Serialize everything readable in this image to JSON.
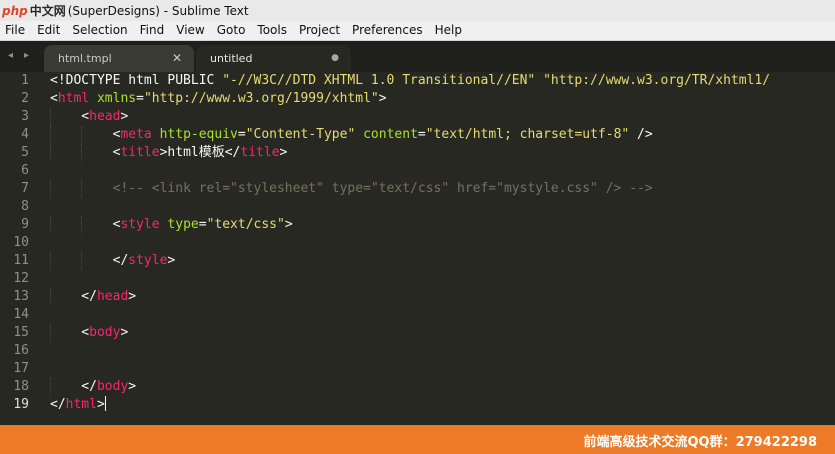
{
  "window": {
    "logo_php": "php",
    "logo_cn": "中文网",
    "title": "(SuperDesigns) - Sublime Text"
  },
  "menu": [
    "File",
    "Edit",
    "Selection",
    "Find",
    "View",
    "Goto",
    "Tools",
    "Project",
    "Preferences",
    "Help"
  ],
  "tabs": {
    "nav_left": "◂",
    "nav_right": "▸",
    "items": [
      {
        "label": "html.tmpl",
        "control": "✕",
        "active": false
      },
      {
        "label": "untitled",
        "control": "●",
        "active": true
      }
    ]
  },
  "editor": {
    "current_line": 19,
    "lines": [
      {
        "n": "1",
        "tokens": [
          {
            "t": "<!DOCTYPE html PUBLIC ",
            "c": ""
          },
          {
            "t": "\"-//W3C//DTD XHTML 1.0 Transitional//EN\"",
            "c": "s"
          },
          {
            "t": " ",
            "c": ""
          },
          {
            "t": "\"http://www.w3.org/TR/xhtml1/",
            "c": "s"
          }
        ]
      },
      {
        "n": "2",
        "tokens": [
          {
            "t": "<",
            "c": ""
          },
          {
            "t": "html",
            "c": "t"
          },
          {
            "t": " ",
            "c": ""
          },
          {
            "t": "xmlns",
            "c": "a"
          },
          {
            "t": "=",
            "c": ""
          },
          {
            "t": "\"http://www.w3.org/1999/xhtml\"",
            "c": "s"
          },
          {
            "t": ">",
            "c": ""
          }
        ]
      },
      {
        "n": "3",
        "tokens": [
          {
            "t": "    <",
            "c": ""
          },
          {
            "t": "head",
            "c": "t"
          },
          {
            "t": ">",
            "c": ""
          }
        ]
      },
      {
        "n": "4",
        "tokens": [
          {
            "t": "        <",
            "c": ""
          },
          {
            "t": "meta",
            "c": "t"
          },
          {
            "t": " ",
            "c": ""
          },
          {
            "t": "http-equiv",
            "c": "a"
          },
          {
            "t": "=",
            "c": ""
          },
          {
            "t": "\"Content-Type\"",
            "c": "s"
          },
          {
            "t": " ",
            "c": ""
          },
          {
            "t": "content",
            "c": "a"
          },
          {
            "t": "=",
            "c": ""
          },
          {
            "t": "\"text/html; charset=utf-8\"",
            "c": "s"
          },
          {
            "t": " />",
            "c": ""
          }
        ]
      },
      {
        "n": "5",
        "tokens": [
          {
            "t": "        <",
            "c": ""
          },
          {
            "t": "title",
            "c": "t"
          },
          {
            "t": ">html模板</",
            "c": ""
          },
          {
            "t": "title",
            "c": "t"
          },
          {
            "t": ">",
            "c": ""
          }
        ]
      },
      {
        "n": "6",
        "tokens": []
      },
      {
        "n": "7",
        "tokens": [
          {
            "t": "        ",
            "c": ""
          },
          {
            "t": "<!-- <link rel=\"stylesheet\" type=\"text/css\" href=\"mystyle.css\" /> -->",
            "c": "c"
          }
        ]
      },
      {
        "n": "8",
        "tokens": []
      },
      {
        "n": "9",
        "tokens": [
          {
            "t": "        <",
            "c": ""
          },
          {
            "t": "style",
            "c": "t"
          },
          {
            "t": " ",
            "c": ""
          },
          {
            "t": "type",
            "c": "a"
          },
          {
            "t": "=",
            "c": ""
          },
          {
            "t": "\"text/css\"",
            "c": "s"
          },
          {
            "t": ">",
            "c": ""
          }
        ]
      },
      {
        "n": "10",
        "tokens": []
      },
      {
        "n": "11",
        "tokens": [
          {
            "t": "        </",
            "c": ""
          },
          {
            "t": "style",
            "c": "t"
          },
          {
            "t": ">",
            "c": ""
          }
        ]
      },
      {
        "n": "12",
        "tokens": []
      },
      {
        "n": "13",
        "tokens": [
          {
            "t": "    </",
            "c": ""
          },
          {
            "t": "head",
            "c": "t"
          },
          {
            "t": ">",
            "c": ""
          }
        ]
      },
      {
        "n": "14",
        "tokens": []
      },
      {
        "n": "15",
        "tokens": [
          {
            "t": "    <",
            "c": ""
          },
          {
            "t": "body",
            "c": "t"
          },
          {
            "t": ">",
            "c": ""
          }
        ]
      },
      {
        "n": "16",
        "tokens": []
      },
      {
        "n": "17",
        "tokens": []
      },
      {
        "n": "18",
        "tokens": [
          {
            "t": "    </",
            "c": ""
          },
          {
            "t": "body",
            "c": "t"
          },
          {
            "t": ">",
            "c": ""
          }
        ]
      },
      {
        "n": "19",
        "tokens": [
          {
            "t": "</",
            "c": ""
          },
          {
            "t": "html",
            "c": "t"
          },
          {
            "t": ">",
            "c": ""
          }
        ]
      }
    ]
  },
  "banner": {
    "text": "前端高级技术交流QQ群：279422298"
  },
  "colors": {
    "background": "#272822",
    "tag": "#f92672",
    "attribute": "#a6e22e",
    "string": "#e6db74",
    "comment": "#75715e",
    "banner": "#ec7a26"
  }
}
